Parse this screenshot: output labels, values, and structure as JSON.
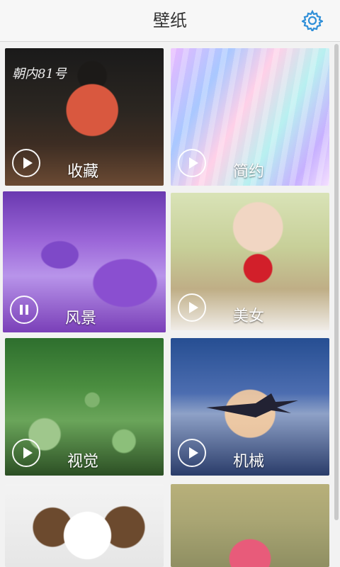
{
  "header": {
    "title": "壁纸",
    "settings_icon": "gear-icon",
    "accent": "#2f8fd8"
  },
  "tiles": [
    {
      "label": "收藏",
      "state": "play",
      "overlay_text": "朝内81号"
    },
    {
      "label": "简约",
      "state": "play"
    },
    {
      "label": "风景",
      "state": "pause",
      "selected": true
    },
    {
      "label": "美女",
      "state": "play"
    },
    {
      "label": "视觉",
      "state": "play"
    },
    {
      "label": "机械",
      "state": "play"
    },
    {
      "label": "",
      "state": "none"
    },
    {
      "label": "",
      "state": "none"
    }
  ]
}
